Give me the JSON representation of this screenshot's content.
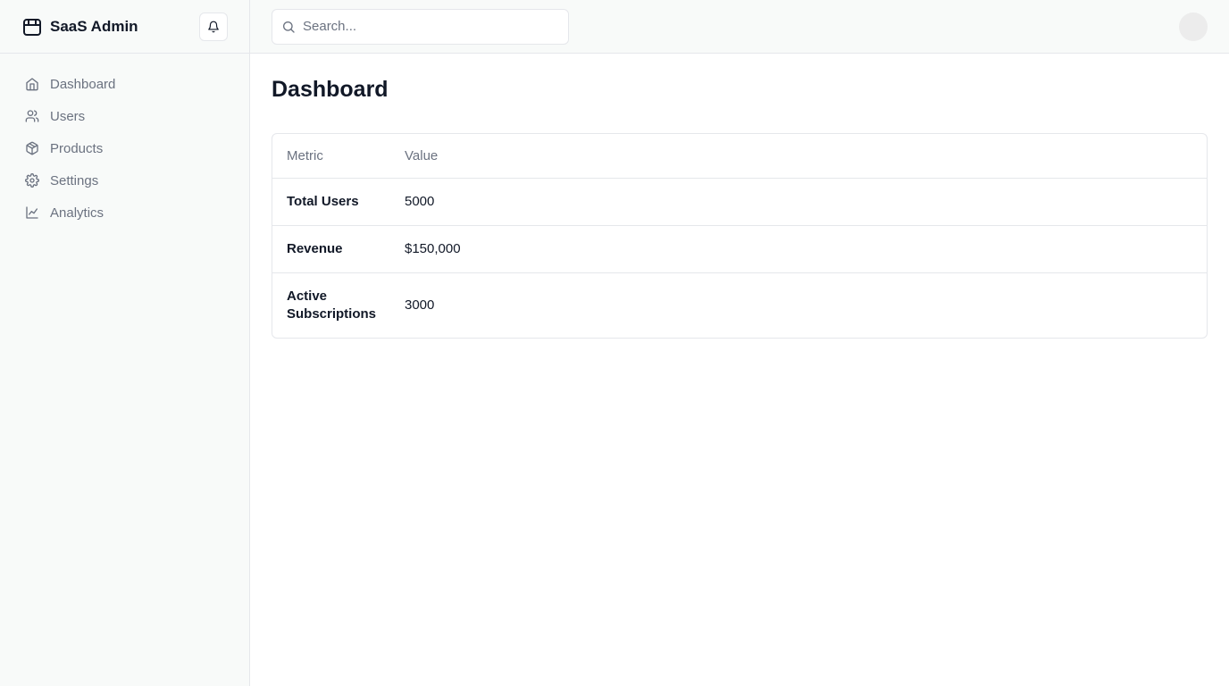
{
  "app": {
    "name": "SaaS Admin",
    "brand_icon": "box-icon"
  },
  "header": {
    "notification_icon": "bell-icon",
    "search_placeholder": "Search...",
    "search_value": ""
  },
  "sidebar": {
    "items": [
      {
        "label": "Dashboard",
        "icon": "home-icon"
      },
      {
        "label": "Users",
        "icon": "users-icon"
      },
      {
        "label": "Products",
        "icon": "package-icon"
      },
      {
        "label": "Settings",
        "icon": "gear-icon"
      },
      {
        "label": "Analytics",
        "icon": "line-chart-icon"
      }
    ]
  },
  "main": {
    "title": "Dashboard",
    "table": {
      "columns": [
        "Metric",
        "Value"
      ],
      "rows": [
        {
          "metric": "Total Users",
          "value": "5000"
        },
        {
          "metric": "Revenue",
          "value": "$150,000"
        },
        {
          "metric": "Active Subscriptions",
          "value": "3000"
        }
      ]
    }
  },
  "colors": {
    "sidebar_bg": "#f8faf9",
    "border": "#e5e7eb",
    "muted_text": "#6b7280",
    "text": "#111827"
  }
}
